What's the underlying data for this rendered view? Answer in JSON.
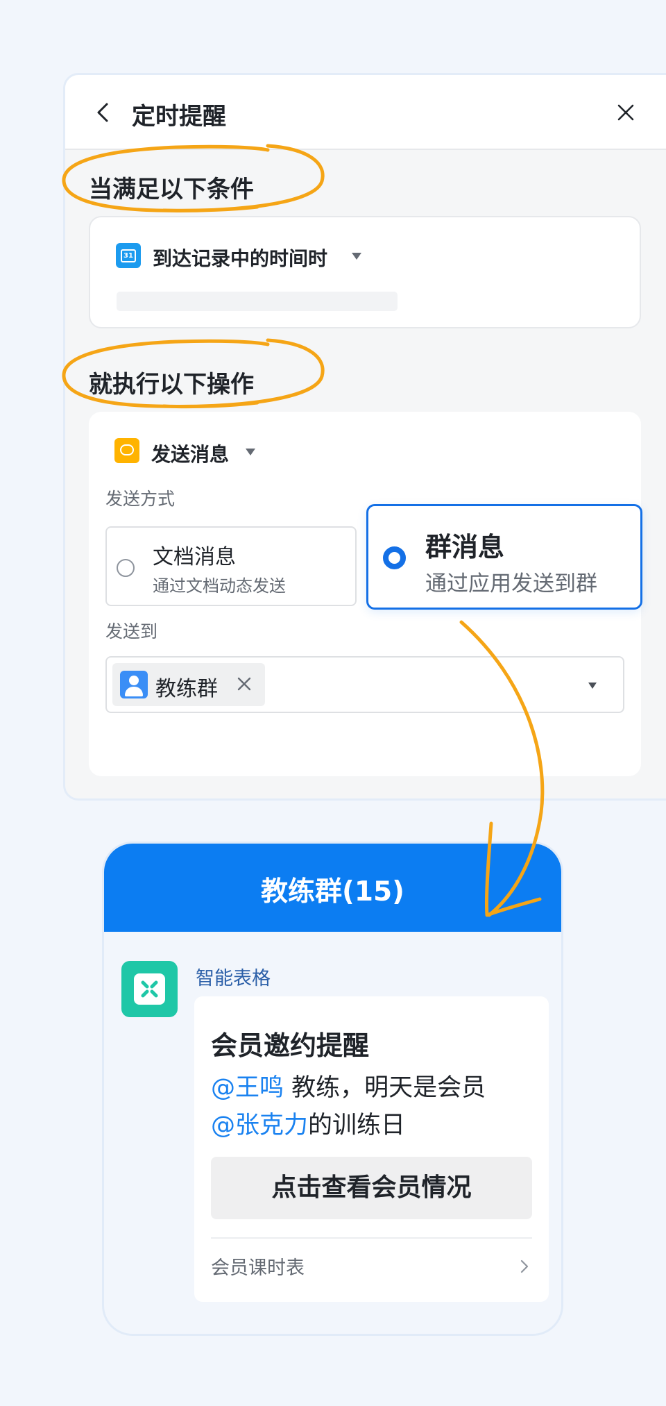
{
  "panel": {
    "title": "定时提醒",
    "condition": {
      "heading": "当满足以下条件",
      "trigger_label": "到达记录中的时间时",
      "calendar_day": "31"
    },
    "action": {
      "heading": "就执行以下操作",
      "action_label": "发送消息",
      "send_method_label": "发送方式",
      "doc_option": {
        "title": "文档消息",
        "subtitle": "通过文档动态发送",
        "selected": false
      },
      "group_option": {
        "title": "群消息",
        "subtitle": "通过应用发送到群",
        "selected": true
      },
      "send_to_label": "发送到",
      "recipient_tag": "教练群"
    }
  },
  "chat": {
    "title": "教练群(15)",
    "sender": "智能表格",
    "card": {
      "title": "会员邀约提醒",
      "mention_1": "@王鸣",
      "text_1": " 教练，明天是会员",
      "mention_2": "@张克力",
      "text_2": "的训练日",
      "button": "点击查看会员情况",
      "footer_link": "会员课时表"
    }
  },
  "colors": {
    "accent_blue": "#1470e6",
    "chat_header": "#0c7df2",
    "highlight_orange": "#f5a516",
    "mention_blue": "#1a82f0",
    "bot_green": "#1fc7a7"
  }
}
